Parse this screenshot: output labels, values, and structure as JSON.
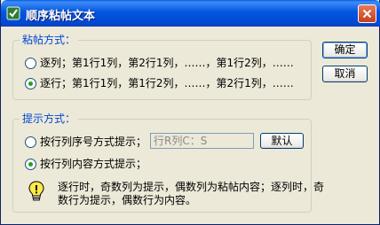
{
  "window": {
    "title": "顺序粘帖文本"
  },
  "paste_group": {
    "label": "粘帖方式：",
    "options": [
      {
        "label": "逐列；第1行1列，第2行1列，……，第1行2列，……",
        "checked": false
      },
      {
        "label": "逐行；第1行1列，第1行2列，……，第2行1列，……",
        "checked": true
      }
    ]
  },
  "hint_group": {
    "label": "提示方式：",
    "option_serial": {
      "label": "按行列序号方式提示；",
      "checked": false
    },
    "serial_field": {
      "value": "行R列C：S"
    },
    "default_button": "默认",
    "option_content": {
      "label": "按行列内容方式提示；",
      "checked": true
    },
    "note": "逐行时，奇数列为提示，偶数列为粘帖内容；逐列时，奇数行为提示，偶数行为内容。"
  },
  "buttons": {
    "ok": "确定",
    "cancel": "取消"
  },
  "icons": {
    "app": "paste-app-icon",
    "close": "close-icon",
    "hint": "lightbulb-icon"
  }
}
